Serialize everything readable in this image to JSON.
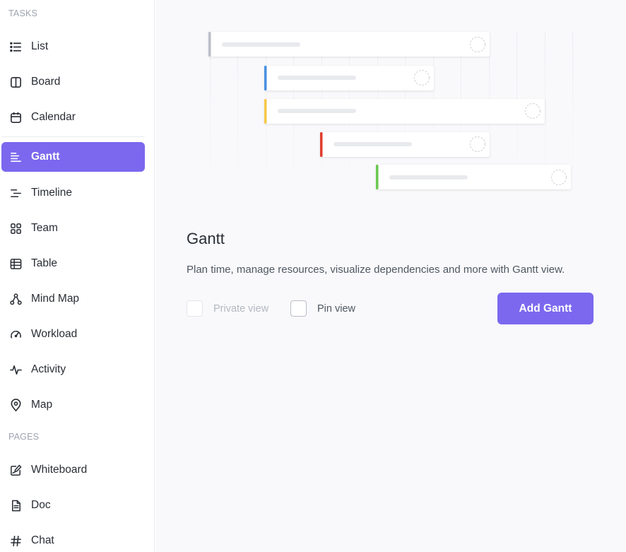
{
  "sidebar": {
    "tasks_section": "TASKS",
    "pages_section": "PAGES",
    "tasks_items": [
      {
        "label": "List",
        "icon": "list-icon"
      },
      {
        "label": "Board",
        "icon": "board-icon"
      },
      {
        "label": "Calendar",
        "icon": "calendar-icon"
      },
      {
        "label": "Gantt",
        "icon": "gantt-icon",
        "active": true
      },
      {
        "label": "Timeline",
        "icon": "timeline-icon"
      },
      {
        "label": "Team",
        "icon": "team-grid-icon"
      },
      {
        "label": "Table",
        "icon": "table-icon"
      },
      {
        "label": "Mind Map",
        "icon": "mind-map-icon"
      },
      {
        "label": "Workload",
        "icon": "workload-gauge-icon"
      },
      {
        "label": "Activity",
        "icon": "activity-pulse-icon"
      },
      {
        "label": "Map",
        "icon": "map-pin-icon"
      }
    ],
    "pages_items": [
      {
        "label": "Whiteboard",
        "icon": "whiteboard-icon"
      },
      {
        "label": "Doc",
        "icon": "doc-icon"
      },
      {
        "label": "Chat",
        "icon": "hash-icon"
      }
    ]
  },
  "main": {
    "title": "Gantt",
    "description": "Plan time, manage resources, visualize dependencies and more with Gantt view.",
    "private_view_label": "Private view",
    "pin_view_label": "Pin view",
    "add_button_label": "Add Gantt",
    "illustration_bar_colors": [
      "#b9bec7",
      "#4a90e2",
      "#f7c948",
      "#e03e2d",
      "#6bc950"
    ]
  },
  "colors": {
    "accent": "#7b68ee",
    "background": "#f9f9fb"
  }
}
